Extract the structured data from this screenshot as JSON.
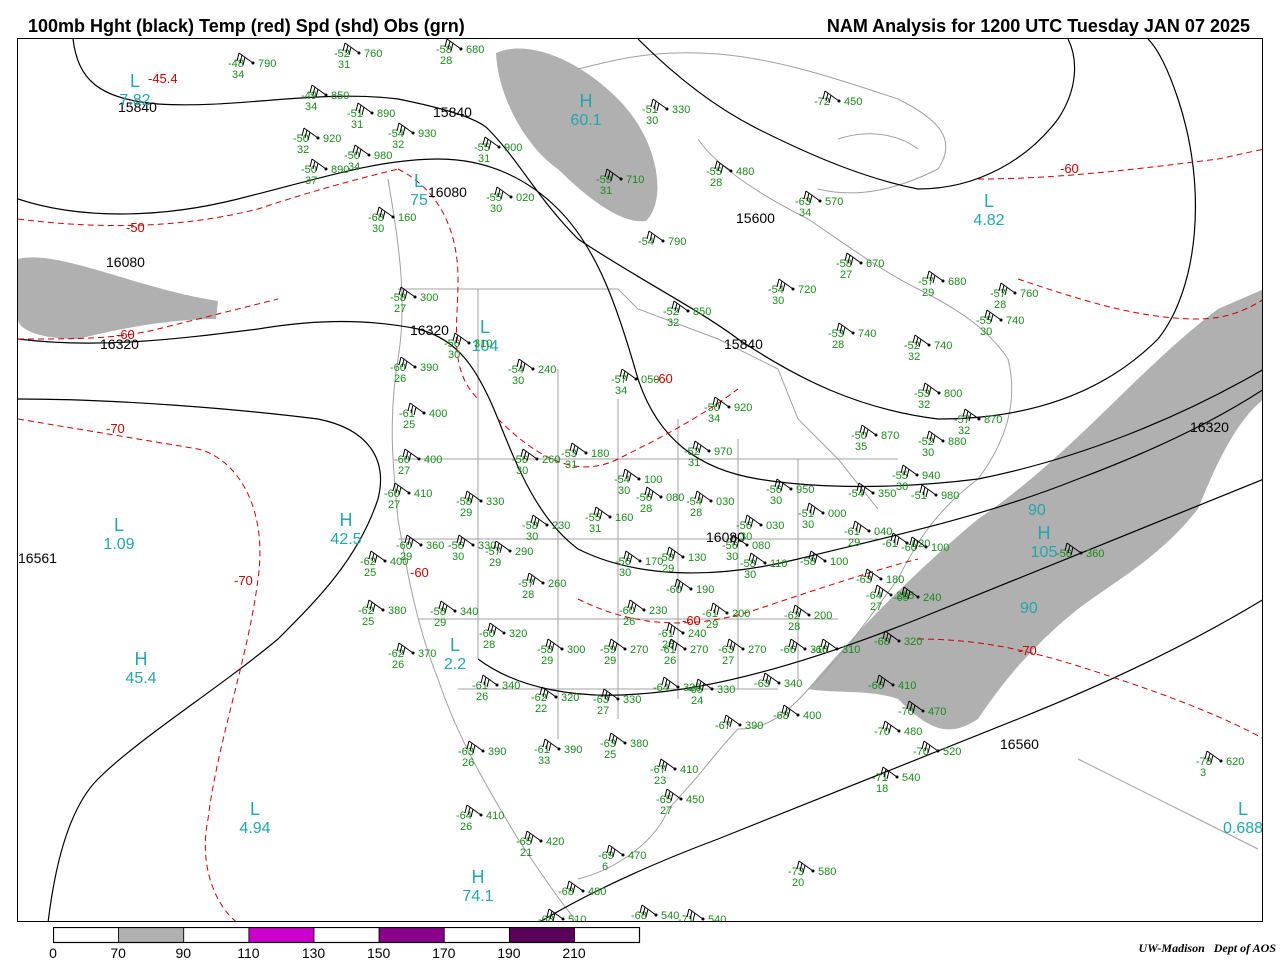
{
  "title_left": "100mb Hght (black) Temp (red) Spd (shd) Obs (grn)",
  "title_right": "NAM Analysis for 1200 UTC Tuesday  JAN 07 2025",
  "credit": {
    "org": "UW-Madison",
    "dept": "Dept of AOS"
  },
  "colors": {
    "height": "#000000",
    "temp": "#cc0000",
    "obs": "#1a8a1a",
    "center": "#22a6b0",
    "shade": "#b0b0b0",
    "coast": "#a0a0a0"
  },
  "colorbar": {
    "ticks": [
      "0",
      "70",
      "90",
      "110",
      "130",
      "150",
      "170",
      "190",
      "210"
    ],
    "fills": [
      "#ffffff",
      "#b0b0b0",
      "#ffffff",
      "#cc00cc",
      "#ffffff",
      "#8b008b",
      "#ffffff",
      "#5a005a"
    ]
  },
  "height_labels": [
    "15840",
    "15840",
    "16080",
    "16080",
    "16320",
    "16320",
    "15600",
    "15840",
    "16320",
    "16080",
    "16560",
    "16561"
  ],
  "temp_labels": [
    "-50",
    "-60",
    "-70",
    "-70",
    "-60",
    "-60",
    "-60",
    "-60",
    "-70",
    "-45.4"
  ],
  "centers": [
    {
      "letter": "L",
      "value": "7.82"
    },
    {
      "letter": "H",
      "value": "60.1"
    },
    {
      "letter": "L",
      "value": "75"
    },
    {
      "letter": "L",
      "value": "4.82"
    },
    {
      "letter": "L",
      "value": "104"
    },
    {
      "letter": "L",
      "value": "1.09"
    },
    {
      "letter": "H",
      "value": "42.5"
    },
    {
      "letter": "H",
      "value": "105"
    },
    {
      "letter": "L",
      "value": "2.2"
    },
    {
      "letter": "H",
      "value": "45.4"
    },
    {
      "letter": "L",
      "value": "4.94"
    },
    {
      "letter": "H",
      "value": "74.1"
    },
    {
      "letter": "L",
      "value": "0.688"
    }
  ],
  "speed_labels": [
    "90",
    "90"
  ],
  "obs": [
    {
      "t": "-48",
      "h": "790",
      "d": "34"
    },
    {
      "t": "-52",
      "h": "760",
      "d": "31"
    },
    {
      "t": "-58",
      "h": "680",
      "d": "28"
    },
    {
      "t": "-49",
      "h": "850",
      "d": "34"
    },
    {
      "t": "-51",
      "h": "890",
      "d": "31"
    },
    {
      "t": "-54",
      "h": "930",
      "d": "32"
    },
    {
      "t": "-50",
      "h": "920",
      "d": "32"
    },
    {
      "t": "-55",
      "h": "900",
      "d": "31"
    },
    {
      "t": "-50",
      "h": "890",
      "d": "37"
    },
    {
      "t": "-50",
      "h": "980",
      "d": "34"
    },
    {
      "t": "-59",
      "h": "710",
      "d": "31"
    },
    {
      "t": "-51",
      "h": "330",
      "d": "30"
    },
    {
      "t": "-72",
      "h": "450",
      "d": ""
    },
    {
      "t": "-55",
      "h": "480",
      "d": "28"
    },
    {
      "t": "-55",
      "h": "020",
      "d": "30"
    },
    {
      "t": "-68",
      "h": "160",
      "d": "30"
    },
    {
      "t": "-63",
      "h": "570",
      "d": "34"
    },
    {
      "t": "-54",
      "h": "790",
      "d": ""
    },
    {
      "t": "-58",
      "h": "670",
      "d": "27"
    },
    {
      "t": "-57",
      "h": "680",
      "d": "29"
    },
    {
      "t": "-57",
      "h": "760",
      "d": "28"
    },
    {
      "t": "-58",
      "h": "300",
      "d": "27"
    },
    {
      "t": "-54",
      "h": "720",
      "d": "30"
    },
    {
      "t": "-52",
      "h": "850",
      "d": "32"
    },
    {
      "t": "-53",
      "h": "740",
      "d": "28"
    },
    {
      "t": "-55",
      "h": "740",
      "d": "30"
    },
    {
      "t": "-56",
      "h": "310",
      "d": "30"
    },
    {
      "t": "-52",
      "h": "740",
      "d": "32"
    },
    {
      "t": "-60",
      "h": "390",
      "d": "26"
    },
    {
      "t": "-54",
      "h": "240",
      "d": "30"
    },
    {
      "t": "-57",
      "h": "050",
      "d": "34"
    },
    {
      "t": "-53",
      "h": "800",
      "d": "32"
    },
    {
      "t": "-61",
      "h": "400",
      "d": "25"
    },
    {
      "t": "-50",
      "h": "920",
      "d": "34"
    },
    {
      "t": "-57",
      "h": "870",
      "d": "32"
    },
    {
      "t": "-50",
      "h": "870",
      "d": "35"
    },
    {
      "t": "-52",
      "h": "880",
      "d": "30"
    },
    {
      "t": "-60",
      "h": "400",
      "d": "27"
    },
    {
      "t": "-56",
      "h": "260",
      "d": "30"
    },
    {
      "t": "-53",
      "h": "180",
      "d": "31"
    },
    {
      "t": "-52",
      "h": "970",
      "d": "31"
    },
    {
      "t": "-55",
      "h": "940",
      "d": "30"
    },
    {
      "t": "-60",
      "h": "410",
      "d": "27"
    },
    {
      "t": "-58",
      "h": "330",
      "d": "29"
    },
    {
      "t": "-54",
      "h": "100",
      "d": "30"
    },
    {
      "t": "-56",
      "h": "080",
      "d": "28"
    },
    {
      "t": "-54",
      "h": "030",
      "d": "28"
    },
    {
      "t": "-56",
      "h": "950",
      "d": "30"
    },
    {
      "t": "-54",
      "h": "350",
      "d": ""
    },
    {
      "t": "-51",
      "h": "980",
      "d": ""
    },
    {
      "t": "-55",
      "h": "160",
      "d": "31"
    },
    {
      "t": "-56",
      "h": "030",
      "d": "30"
    },
    {
      "t": "-51",
      "h": "000",
      "d": "30"
    },
    {
      "t": "-60",
      "h": "360",
      "d": "29"
    },
    {
      "t": "-56",
      "h": "330",
      "d": "30"
    },
    {
      "t": "-58",
      "h": "230",
      "d": "30"
    },
    {
      "t": "-57",
      "h": "290",
      "d": "29"
    },
    {
      "t": "-61",
      "h": "040",
      "d": "29"
    },
    {
      "t": "-61",
      "h": "020",
      "d": ""
    },
    {
      "t": "-60",
      "h": "100",
      "d": ""
    },
    {
      "t": "-62",
      "h": "400",
      "d": "25"
    },
    {
      "t": "-56",
      "h": "170",
      "d": "30"
    },
    {
      "t": "-58",
      "h": "130",
      "d": "29"
    },
    {
      "t": "-56",
      "h": "080",
      "d": "30"
    },
    {
      "t": "-58",
      "h": "110",
      "d": "30"
    },
    {
      "t": "-58",
      "h": "100",
      "d": ""
    },
    {
      "t": "-57",
      "h": "260",
      "d": "28"
    },
    {
      "t": "-60",
      "h": "190",
      "d": ""
    },
    {
      "t": "-63",
      "h": "180",
      "d": ""
    },
    {
      "t": "-64",
      "h": "205",
      "d": "27"
    },
    {
      "t": "-65",
      "h": "240",
      "d": ""
    },
    {
      "t": "-62",
      "h": "380",
      "d": "25"
    },
    {
      "t": "-58",
      "h": "340",
      "d": "29"
    },
    {
      "t": "-60",
      "h": "230",
      "d": "26"
    },
    {
      "t": "-61",
      "h": "200",
      "d": "29"
    },
    {
      "t": "-62",
      "h": "200",
      "d": "28"
    },
    {
      "t": "-60",
      "h": "320",
      "d": "28"
    },
    {
      "t": "-61",
      "h": "240",
      "d": "26"
    },
    {
      "t": "-68",
      "h": "320",
      "d": ""
    },
    {
      "t": "-62",
      "h": "370",
      "d": "26"
    },
    {
      "t": "-58",
      "h": "300",
      "d": "29"
    },
    {
      "t": "-59",
      "h": "270",
      "d": "29"
    },
    {
      "t": "-61",
      "h": "270",
      "d": "26"
    },
    {
      "t": "-63",
      "h": "270",
      "d": "27"
    },
    {
      "t": "-66",
      "h": "310",
      "d": ""
    },
    {
      "t": "-66",
      "h": "310",
      "d": ""
    },
    {
      "t": "-61",
      "h": "340",
      "d": "26"
    },
    {
      "t": "-62",
      "h": "320",
      "d": "22"
    },
    {
      "t": "-63",
      "h": "330",
      "d": "27"
    },
    {
      "t": "-64",
      "h": "320",
      "d": ""
    },
    {
      "t": "-65",
      "h": "330",
      "d": "24"
    },
    {
      "t": "-63",
      "h": "340",
      "d": ""
    },
    {
      "t": "-66",
      "h": "410",
      "d": ""
    },
    {
      "t": "-67",
      "h": "390",
      "d": ""
    },
    {
      "t": "-68",
      "h": "400",
      "d": ""
    },
    {
      "t": "-70",
      "h": "470",
      "d": ""
    },
    {
      "t": "-70",
      "h": "480",
      "d": ""
    },
    {
      "t": "-70",
      "h": "520",
      "d": ""
    },
    {
      "t": "-71",
      "h": "540",
      "d": "18"
    },
    {
      "t": "-63",
      "h": "390",
      "d": "26"
    },
    {
      "t": "-61",
      "h": "390",
      "d": "33"
    },
    {
      "t": "-63",
      "h": "380",
      "d": "25"
    },
    {
      "t": "-67",
      "h": "410",
      "d": "23"
    },
    {
      "t": "-78",
      "h": "620",
      "d": "3"
    },
    {
      "t": "-65",
      "h": "450",
      "d": "27"
    },
    {
      "t": "-64",
      "h": "410",
      "d": "26"
    },
    {
      "t": "-65",
      "h": "420",
      "d": "21"
    },
    {
      "t": "-69",
      "h": "470",
      "d": "6"
    },
    {
      "t": "-73",
      "h": "580",
      "d": "20"
    },
    {
      "t": "-68",
      "h": "480",
      "d": ""
    },
    {
      "t": "-68",
      "h": "510",
      "d": ""
    },
    {
      "t": "-68",
      "h": "540",
      "d": ""
    },
    {
      "t": "-71",
      "h": "540",
      "d": ""
    },
    {
      "t": "-56",
      "h": "360",
      "d": ""
    }
  ]
}
